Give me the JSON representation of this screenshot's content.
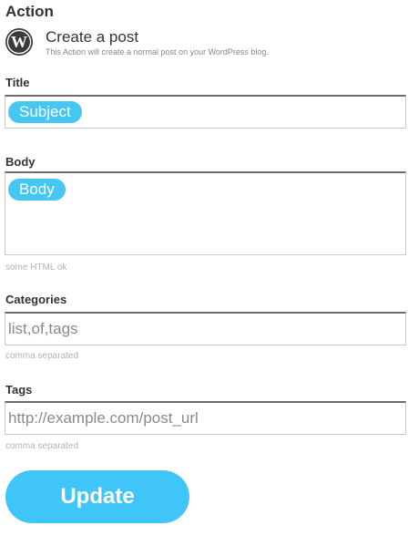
{
  "action": {
    "heading": "Action",
    "icon": "wordpress-icon",
    "title": "Create a post",
    "description": "This Action will create a normal post on your WordPress blog."
  },
  "fields": {
    "title": {
      "label": "Title",
      "token": "Subject"
    },
    "body": {
      "label": "Body",
      "token": "Body",
      "hint": "some HTML ok"
    },
    "categories": {
      "label": "Categories",
      "placeholder": "list,of,tags",
      "hint": "comma separated"
    },
    "tags": {
      "label": "Tags",
      "placeholder": "http://example.com/post_url",
      "hint": "comma separated"
    }
  },
  "update_button": {
    "label": "Update"
  },
  "colors": {
    "accent": "#40c5f8",
    "token_bg": "#45c6f3",
    "text": "#333333",
    "hint": "#b3b3b3"
  }
}
